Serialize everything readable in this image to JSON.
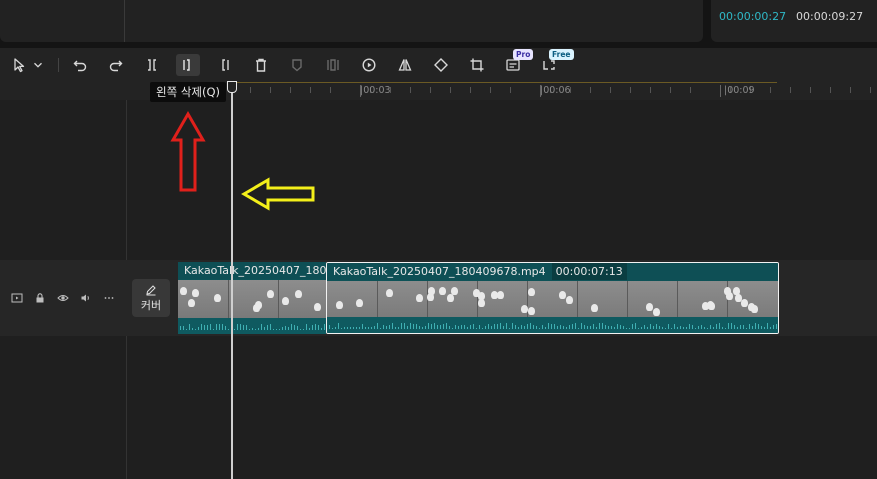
{
  "preview": {
    "current_time": "00:00:00:27",
    "total_time": "00:00:09:27"
  },
  "toolbar": {
    "tooltip": "왼쪽 삭제(Q)",
    "badges": {
      "pro": "Pro",
      "free": "Free"
    }
  },
  "ruler": {
    "labels": [
      "|00:03",
      "|00:06",
      "|00:09"
    ]
  },
  "track": {
    "cover_label": "커버",
    "clips": [
      {
        "name": "KakaoTalk_20250407_18040",
        "duration": ""
      },
      {
        "name": "KakaoTalk_20250407_180409678.mp4",
        "duration": "00:00:07:13"
      }
    ]
  },
  "colors": {
    "accent": "#2fb8c6",
    "clip": "#0d5257",
    "annotation_red": "#e0201b",
    "annotation_yellow": "#f3ef1a"
  }
}
